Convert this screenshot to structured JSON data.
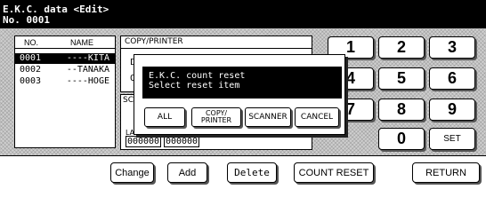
{
  "header": {
    "title": "E.K.C. data <Edit>",
    "number": "No. 0001"
  },
  "list": {
    "col_no": "NO.",
    "col_name": "NAME",
    "rows": [
      {
        "no": "0001",
        "name": "----KITA",
        "selected": true
      },
      {
        "no": "0002",
        "name": "--TANAKA",
        "selected": false
      },
      {
        "no": "0003",
        "name": "----HOGE",
        "selected": false
      }
    ]
  },
  "copy_printer": {
    "label": "COPY/PRINTER",
    "frag_d": "D",
    "frag_0": "0"
  },
  "scanner": {
    "frag_sc": "SC",
    "frag_la": "LA",
    "counts": [
      "000000",
      "000000"
    ]
  },
  "keypad": {
    "keys": [
      "1",
      "2",
      "3",
      "4",
      "5",
      "6",
      "7",
      "8",
      "9",
      "0",
      "SET"
    ]
  },
  "dialog": {
    "line1": "E.K.C. count reset",
    "line2": "Select reset item",
    "buttons": {
      "all": "ALL",
      "copy_top": "COPY/",
      "copy_bottom": "PRINTER",
      "scanner": "SCANNER",
      "cancel": "CANCEL"
    }
  },
  "bottom": {
    "change": "Change",
    "add": "Add",
    "delete": "Delete",
    "count_reset": "COUNT RESET",
    "return": "RETURN"
  }
}
